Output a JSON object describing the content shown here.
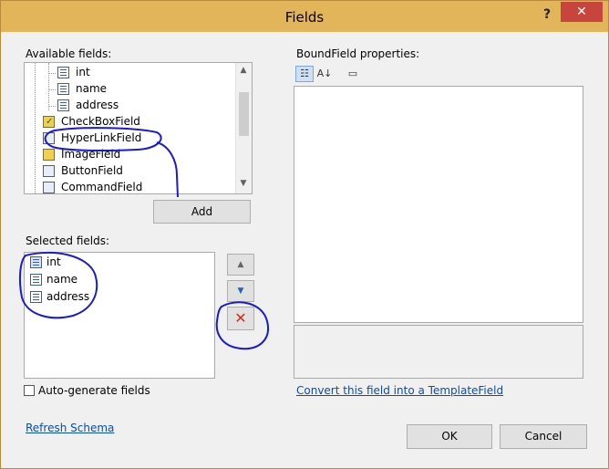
{
  "window": {
    "title": "Fields",
    "help_label": "?",
    "close_label": "✕"
  },
  "available": {
    "label": "Available fields:",
    "items": [
      {
        "label": "int",
        "icon": "field-doc-icon"
      },
      {
        "label": "name",
        "icon": "field-doc-icon"
      },
      {
        "label": "address",
        "icon": "field-doc-icon"
      },
      {
        "label": "CheckBoxField",
        "icon": "checkbox-field-icon"
      },
      {
        "label": "HyperLinkField",
        "icon": "hyperlink-field-icon"
      },
      {
        "label": "ImageField",
        "icon": "image-field-icon"
      },
      {
        "label": "ButtonField",
        "icon": "button-field-icon"
      },
      {
        "label": "CommandField",
        "icon": "command-field-icon"
      }
    ],
    "add_label": "Add"
  },
  "selected": {
    "label": "Selected fields:",
    "items": [
      {
        "label": "int"
      },
      {
        "label": "name"
      },
      {
        "label": "address"
      }
    ],
    "up_glyph": "▲",
    "down_glyph": "▼",
    "delete_glyph": "✕"
  },
  "autogenerate": {
    "label": "Auto-generate fields",
    "checked": false
  },
  "properties": {
    "label": "BoundField properties:",
    "convert_link": "Convert this field into a TemplateField"
  },
  "refresh_link": "Refresh Schema",
  "ok_label": "OK",
  "cancel_label": "Cancel",
  "colors": {
    "title_bar": "#e2b55a",
    "close": "#c7453c",
    "link": "#0a4ea8",
    "annotation": "#1a1ad0",
    "delete": "#d32a1e"
  }
}
